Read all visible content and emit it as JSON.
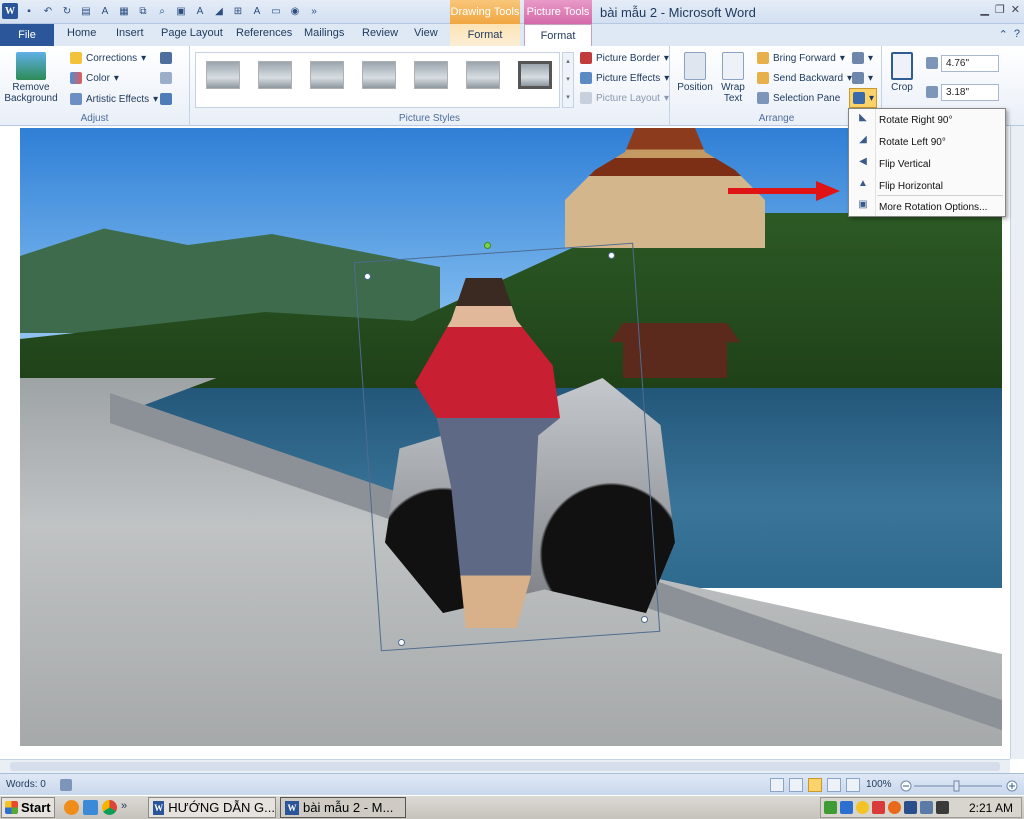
{
  "titlebar": {
    "title": "bài mẫu 2 - Microsoft Word",
    "context_drawing": "Drawing Tools",
    "context_picture": "Picture Tools"
  },
  "tabs": {
    "file": "File",
    "home": "Home",
    "insert": "Insert",
    "page_layout": "Page Layout",
    "references": "References",
    "mailings": "Mailings",
    "review": "Review",
    "view": "View",
    "format_drawing": "Format",
    "format_picture": "Format"
  },
  "ribbon": {
    "adjust": {
      "remove_background_line1": "Remove",
      "remove_background_line2": "Background",
      "corrections": "Corrections",
      "color": "Color",
      "artistic_effects": "Artistic Effects",
      "label": "Adjust"
    },
    "picture_styles": {
      "label": "Picture Styles",
      "picture_border": "Picture Border",
      "picture_effects": "Picture Effects",
      "picture_layout": "Picture Layout"
    },
    "arrange": {
      "label": "Arrange",
      "position": "Position",
      "wrap_text_line1": "Wrap",
      "wrap_text_line2": "Text",
      "bring_forward": "Bring Forward",
      "send_backward": "Send Backward",
      "selection_pane": "Selection Pane"
    },
    "size": {
      "crop": "Crop",
      "height": "4.76\"",
      "width": "3.18\""
    }
  },
  "rotate_menu": {
    "items": [
      {
        "label": "Rotate Right 90°"
      },
      {
        "label": "Rotate Left 90°"
      },
      {
        "label": "Flip Vertical"
      },
      {
        "label": "Flip Horizontal"
      },
      {
        "label": "More Rotation Options..."
      }
    ]
  },
  "statusbar": {
    "words": "Words: 0",
    "zoom": "100%"
  },
  "taskbar": {
    "start": "Start",
    "task1": "HƯỚNG DẪN G...",
    "task2": "bài mẫu 2 - M...",
    "clock": "2:21 AM"
  },
  "colors": {
    "file_tab": "#2b579a",
    "drawing_tools": "#f0a640",
    "picture_tools": "#d46aa8",
    "arrow": "#e01414"
  }
}
